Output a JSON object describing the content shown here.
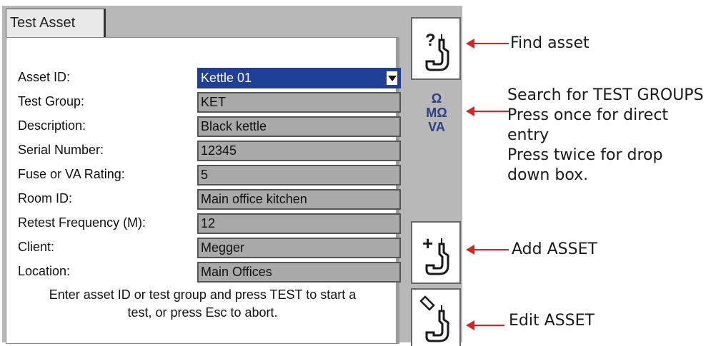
{
  "tab": {
    "label": "Test Asset"
  },
  "fields": [
    {
      "label": "Asset ID:",
      "value": "Kettle 01",
      "selected": true
    },
    {
      "label": "Test Group:",
      "value": "KET"
    },
    {
      "label": "Description:",
      "value": "Black kettle"
    },
    {
      "label": "Serial Number:",
      "value": "12345"
    },
    {
      "label": "Fuse or VA Rating:",
      "value": "5"
    },
    {
      "label": "Room ID:",
      "value": "Main office kitchen"
    },
    {
      "label": "Retest Frequency (M):",
      "value": "12"
    },
    {
      "label": "Client:",
      "value": "Megger"
    },
    {
      "label": "Location:",
      "value": "Main Offices"
    }
  ],
  "hint": {
    "line1": "Enter asset ID or test group and press TEST to start a",
    "line2": "test, or press Esc to abort."
  },
  "softkeys": {
    "find": {
      "glyph": "?"
    },
    "groups": {
      "line1": "Ω",
      "line2": "MΩ",
      "line3": "VA"
    },
    "add": {
      "glyph": "+"
    }
  },
  "callouts": {
    "find": "Find asset",
    "groups": [
      "Search for TEST GROUPS",
      "Press once for direct",
      "entry",
      "Press twice for drop",
      "down box."
    ],
    "add": "Add ASSET",
    "edit": "Edit ASSET"
  },
  "colors": {
    "selection": "#1f3f96",
    "field_fill": "#a9a9a9",
    "arrow": "#e02020",
    "icon_blue": "#2a3f8a"
  }
}
